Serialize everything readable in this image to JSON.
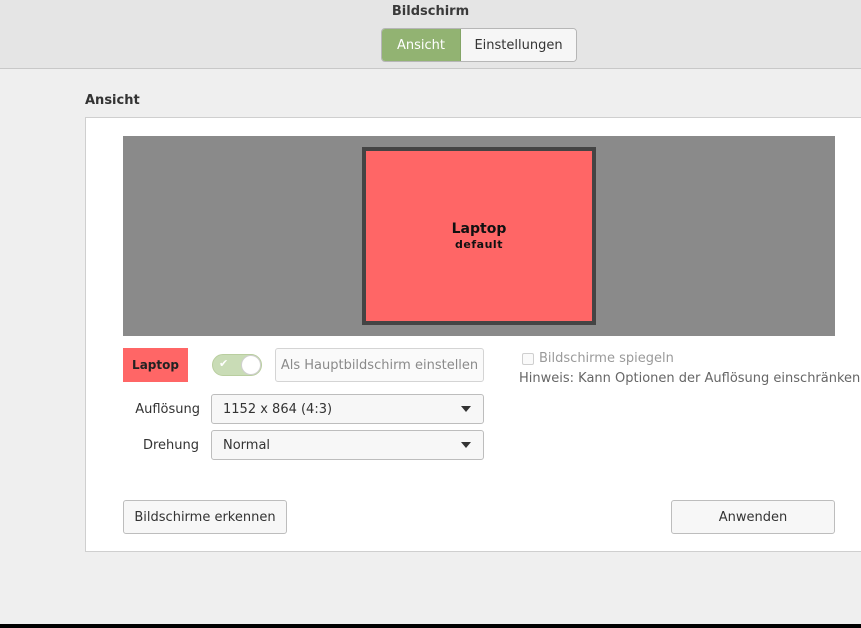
{
  "window": {
    "title": "Bildschirm"
  },
  "tabs": [
    {
      "label": "Ansicht",
      "active": true
    },
    {
      "label": "Einstellungen",
      "active": false
    }
  ],
  "section": {
    "title": "Ansicht"
  },
  "preview": {
    "monitor_name": "Laptop",
    "monitor_subtitle": "default",
    "monitor_color": "#ff6666"
  },
  "output": {
    "badge_label": "Laptop",
    "enabled": true,
    "primary_button_label": "Als Hauptbildschirm einstellen",
    "mirror_label": "Bildschirme spiegeln",
    "mirror_checked": false,
    "hint": "Hinweis: Kann Optionen der Auflösung einschränken",
    "resolution_label": "Auflösung",
    "resolution_value": "1152 x 864 (4:3)",
    "rotation_label": "Drehung",
    "rotation_value": "Normal"
  },
  "footer": {
    "detect_label": "Bildschirme erkennen",
    "apply_label": "Anwenden"
  },
  "colors": {
    "accent": "#92b372",
    "monitor": "#ff6666"
  }
}
